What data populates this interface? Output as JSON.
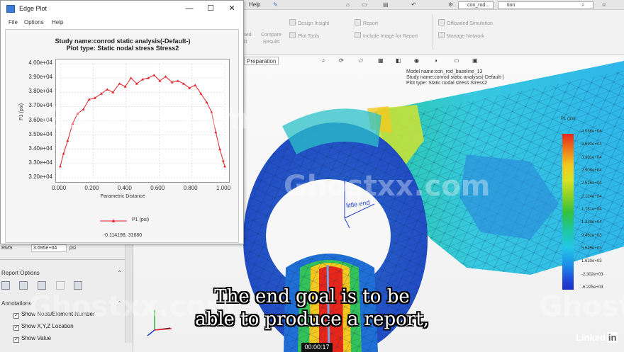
{
  "ribbon": {
    "tabs": [
      {
        "label": "Help"
      }
    ],
    "file_name": "con_rod...",
    "search_value": "tion",
    "buttons": [
      {
        "label": "Design Insight"
      },
      {
        "label": "Plot Tools"
      },
      {
        "label": "Report"
      },
      {
        "label": "Include Image for Report"
      },
      {
        "label": "Offloaded Simulation"
      },
      {
        "label": "Manage Network"
      },
      {
        "label": "Compare"
      },
      {
        "label": "Results"
      },
      {
        "label": "med"
      },
      {
        "label": "ult"
      }
    ]
  },
  "edge_plot": {
    "window_title": "Edge Plot",
    "menu": [
      "File",
      "Options",
      "Help"
    ],
    "title_line1": "Study name:conrod static analysis(-Default-)",
    "title_line2": "Plot type: Static nodal stress Stress2",
    "legend_label": "P1 (psi)",
    "cursor_readout": "-0.114198, 31680"
  },
  "chart_data": {
    "type": "line",
    "title": "Study name:conrod static analysis(-Default-)",
    "subtitle": "Plot type: Static nodal stress Stress2",
    "xlabel": "Parametric Distance",
    "ylabel": "P1 (psi)",
    "xlim": [
      0,
      1
    ],
    "ylim": [
      32000,
      40000
    ],
    "x_ticks": [
      "0.000",
      "0.200",
      "0.400",
      "0.600",
      "0.800",
      "1.000"
    ],
    "y_ticks": [
      "3.20e+04",
      "3.30e+04",
      "3.40e+04",
      "3.50e+04",
      "3.60e+04",
      "3.70e+04",
      "3.80e+04",
      "3.90e+04",
      "4.00e+04"
    ],
    "grid": true,
    "legend": "bottom",
    "series": [
      {
        "name": "P1 (psi)",
        "color": "#e0242a",
        "x": [
          0.0,
          0.02,
          0.045,
          0.075,
          0.105,
          0.14,
          0.175,
          0.21,
          0.25,
          0.285,
          0.32,
          0.36,
          0.395,
          0.43,
          0.465,
          0.5,
          0.535,
          0.57,
          0.605,
          0.64,
          0.68,
          0.715,
          0.75,
          0.785,
          0.82,
          0.855,
          0.89,
          0.92,
          0.945,
          0.97,
          0.99,
          1.0
        ],
        "values": [
          32800,
          33700,
          34600,
          35800,
          36500,
          36800,
          37500,
          37600,
          37900,
          38200,
          38000,
          38600,
          38400,
          39000,
          38600,
          38900,
          39000,
          39200,
          38800,
          39100,
          38700,
          38800,
          38600,
          38300,
          38500,
          37900,
          37300,
          36600,
          35200,
          34000,
          33200,
          32800
        ]
      }
    ]
  },
  "viewport": {
    "tab_label": "Preparation",
    "info_line1": "Model name:con_rod_baseline_13",
    "info_line2": "Study name:conrod static analysis(-Default-)",
    "info_line3": "Plot type: Static nodal stress Stress2",
    "legend_title": "P1 (psi)",
    "legend_values": [
      "4.086e+04",
      "3.693e+04",
      "3.301e+04",
      "2.908e+04",
      "2.516e+04",
      "2.124e+04",
      "1.731e+04",
      "1.339e+04",
      "9.462e+03",
      "5.545e+03",
      "1.620e+03",
      "-2.302e+03",
      "-6.225e+03"
    ],
    "model_label": "little end"
  },
  "left_panel": {
    "rms_label": "RMS",
    "rms_value": "3.695e+04",
    "rms_unit": "psi",
    "report_options_title": "Report Options",
    "annotations_title": "Annotations",
    "checkboxes": [
      {
        "label": "Show Node/Element Number",
        "checked": true
      },
      {
        "label": "Show X,Y,Z Location",
        "checked": true
      },
      {
        "label": "Show Value",
        "checked": true
      }
    ]
  },
  "overlay": {
    "subtitle_line1": "The end goal is to be",
    "subtitle_line2": "able to produce a report,",
    "timecode": "00:00:17",
    "watermark": "Ghostxx.com",
    "brand_text": "Linked",
    "brand_in": "in"
  }
}
